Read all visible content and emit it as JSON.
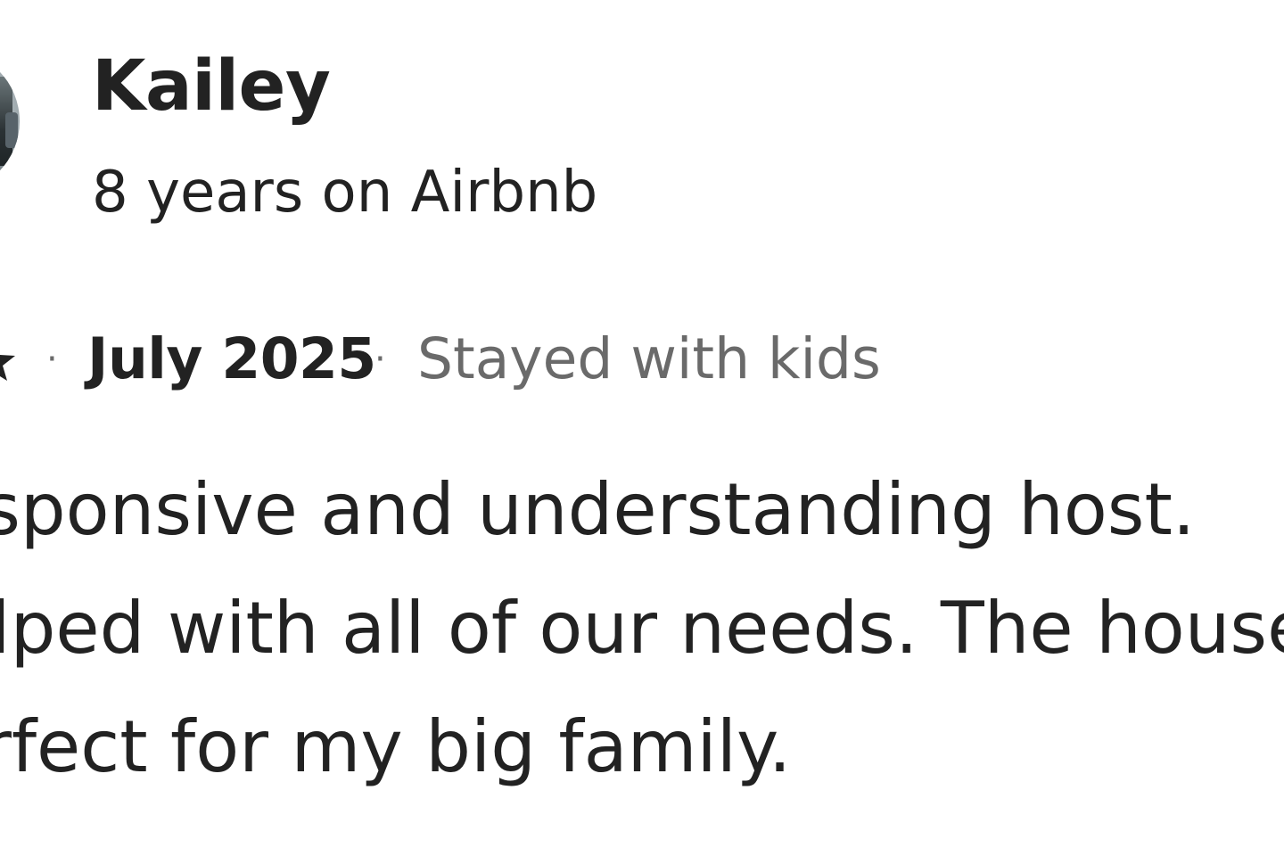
{
  "reviewer": {
    "name": "Kailey",
    "tenure": "8 years on Airbnb"
  },
  "review": {
    "separator": "·",
    "date": "July 2025",
    "trip_type": "Stayed with kids",
    "text_lines": [
      "Responsive and understanding host.",
      "Helped with all of our needs. The house was",
      "perfect for my big family."
    ]
  },
  "icons": {
    "rating": "star-icon",
    "avatar": "user-avatar-photo"
  },
  "colors": {
    "primary_text": "#222222",
    "secondary_text": "#6a6a6a",
    "background": "#ffffff"
  }
}
